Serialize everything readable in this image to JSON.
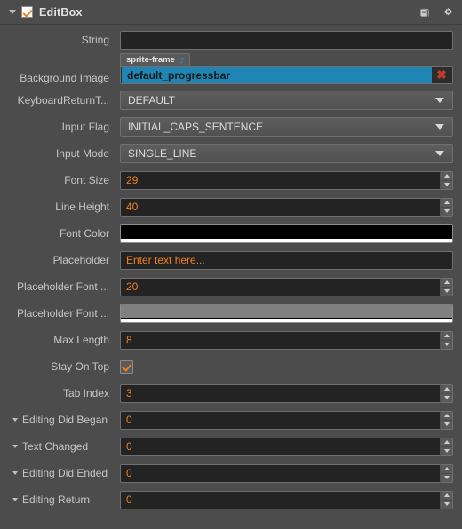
{
  "header": {
    "title": "EditBox",
    "collapse_icon": "triangle-down-icon",
    "enabled_checkbox": "checked",
    "icons": [
      {
        "name": "help-icon",
        "label": "Help"
      },
      {
        "name": "gear-icon",
        "label": "Settings"
      }
    ]
  },
  "accent": {
    "value_orange": "#f08020",
    "select_blue": "#1f85b5",
    "delete_red": "#c0392b",
    "panel_bg": "#4c4c4c",
    "input_bg": "#232323"
  },
  "properties": [
    {
      "label": "String",
      "type": "text",
      "value": ""
    },
    {
      "label": "Background Image",
      "type": "asset",
      "value": "default_progressbar",
      "tag": "sprite-frame",
      "remove": "✖"
    },
    {
      "label": "KeyboardReturnT...",
      "type": "select",
      "value": "DEFAULT"
    },
    {
      "label": "Input Flag",
      "type": "select",
      "value": "INITIAL_CAPS_SENTENCE"
    },
    {
      "label": "Input Mode",
      "type": "select",
      "value": "SINGLE_LINE"
    },
    {
      "label": "Font Size",
      "type": "number",
      "value": "29"
    },
    {
      "label": "Line Height",
      "type": "number",
      "value": "40"
    },
    {
      "label": "Font Color",
      "type": "color",
      "value": "#000000",
      "alpha": "#ffffff"
    },
    {
      "label": "Placeholder",
      "type": "text",
      "value": "Enter text here..."
    },
    {
      "label": "Placeholder Font ...",
      "type": "number",
      "value": "20"
    },
    {
      "label": "Placeholder Font ...",
      "type": "color",
      "value": "#808080",
      "alpha": "#ffffff"
    },
    {
      "label": "Max Length",
      "type": "number",
      "value": "8"
    },
    {
      "label": "Stay On Top",
      "type": "checkbox",
      "value": "checked"
    },
    {
      "label": "Tab Index",
      "type": "number",
      "value": "3"
    }
  ],
  "events": [
    {
      "label": "Editing Did Began",
      "type": "number",
      "value": "0"
    },
    {
      "label": "Text Changed",
      "type": "number",
      "value": "0"
    },
    {
      "label": "Editing Did Ended",
      "type": "number",
      "value": "0"
    },
    {
      "label": "Editing Return",
      "type": "number",
      "value": "0"
    }
  ]
}
